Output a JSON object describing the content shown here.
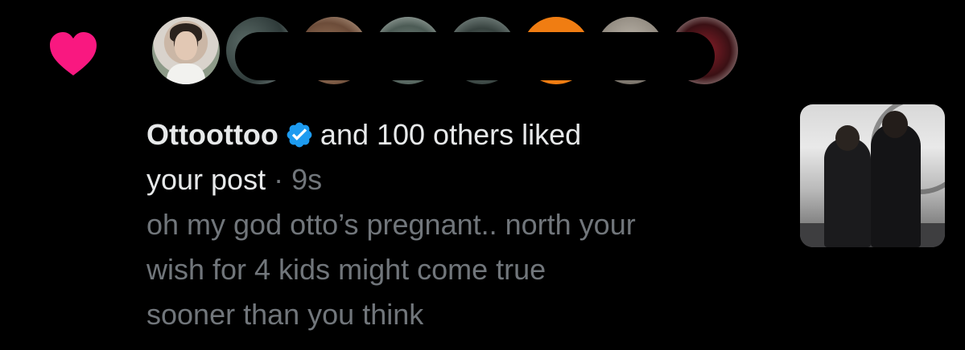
{
  "notification": {
    "type_icon": "heart-icon",
    "type_icon_color": "#f91880",
    "avatar_count_visible": 8,
    "user": {
      "name": "Ottoottoo",
      "verified_icon": "verified-badge-icon",
      "verified_color": "#1d9bf0"
    },
    "action_text": "and 100 others liked",
    "target_text": "your post",
    "separator": "·",
    "time": "9s",
    "post_text_lines": [
      "oh my god otto’s pregnant.. north your",
      "wish for 4 kids might come true",
      "sooner than you think"
    ],
    "colors": {
      "background": "#000000",
      "primary_text": "#e7e9ea",
      "secondary_text": "#71767b"
    }
  }
}
